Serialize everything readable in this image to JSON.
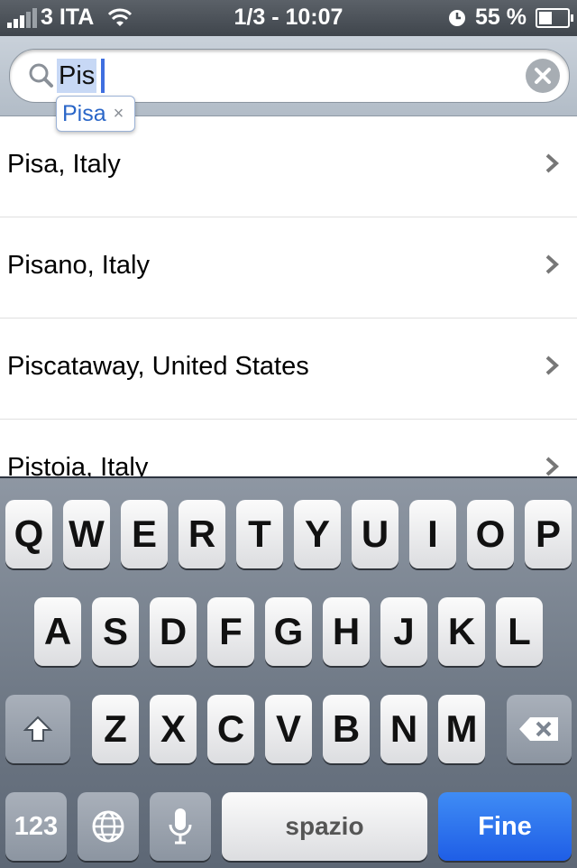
{
  "status": {
    "carrier": "3 ITA",
    "time": "1/3 - 10:07",
    "battery": "55 %",
    "battery_level": 0.55,
    "signal_bars": 3,
    "signal_max": 5
  },
  "search": {
    "query": "Pis",
    "clear_icon": "clear-icon"
  },
  "suggestion": {
    "label": "Pisa",
    "remove": "×"
  },
  "results": [
    {
      "label": "Pisa, Italy"
    },
    {
      "label": "Pisano, Italy"
    },
    {
      "label": "Piscataway, United States"
    },
    {
      "label": "Pistoia, Italy"
    }
  ],
  "keyboard": {
    "row1": [
      "Q",
      "W",
      "E",
      "R",
      "T",
      "Y",
      "U",
      "I",
      "O",
      "P"
    ],
    "row2": [
      "A",
      "S",
      "D",
      "F",
      "G",
      "H",
      "J",
      "K",
      "L"
    ],
    "row3": [
      "Z",
      "X",
      "C",
      "V",
      "B",
      "N",
      "M"
    ],
    "numbers_label": "123",
    "space_label": "spazio",
    "done_label": "Fine"
  }
}
